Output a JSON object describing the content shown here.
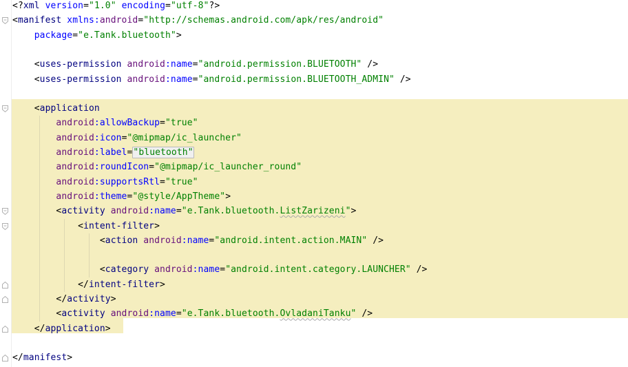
{
  "lines": [
    {
      "indent": "",
      "parts": [
        [
          "p",
          "<"
        ],
        [
          "p",
          "?"
        ],
        [
          "t",
          "xml "
        ],
        [
          "ab",
          "version"
        ],
        [
          "p",
          "="
        ],
        [
          "s",
          "\"1.0\""
        ],
        [
          "p",
          " "
        ],
        [
          "ab",
          "encoding"
        ],
        [
          "p",
          "="
        ],
        [
          "s",
          "\"utf-8\""
        ],
        [
          "p",
          "?>"
        ]
      ]
    },
    {
      "indent": "",
      "parts": [
        [
          "p",
          "<"
        ],
        [
          "t",
          "manifest "
        ],
        [
          "ab",
          "xmlns:"
        ],
        [
          "ans",
          "android"
        ],
        [
          "p",
          "="
        ],
        [
          "s",
          "\"http://schemas.android.com/apk/res/android\""
        ]
      ]
    },
    {
      "indent": "    ",
      "parts": [
        [
          "ab",
          "package"
        ],
        [
          "p",
          "="
        ],
        [
          "s",
          "\"e.Tank.bluetooth\""
        ],
        [
          "p",
          ">"
        ]
      ]
    },
    {
      "indent": "",
      "parts": []
    },
    {
      "indent": "    ",
      "parts": [
        [
          "p",
          "<"
        ],
        [
          "t",
          "uses-permission "
        ],
        [
          "ans",
          "android"
        ],
        [
          "ab",
          ":name"
        ],
        [
          "p",
          "="
        ],
        [
          "s",
          "\"android.permission.BLUETOOTH\""
        ],
        [
          "p",
          " />"
        ]
      ]
    },
    {
      "indent": "    ",
      "parts": [
        [
          "p",
          "<"
        ],
        [
          "t",
          "uses-permission "
        ],
        [
          "ans",
          "android"
        ],
        [
          "ab",
          ":name"
        ],
        [
          "p",
          "="
        ],
        [
          "s",
          "\"android.permission.BLUETOOTH_ADMIN\""
        ],
        [
          "p",
          " />"
        ]
      ]
    },
    {
      "indent": "",
      "parts": []
    },
    {
      "indent": "    ",
      "parts": [
        [
          "p",
          "<"
        ],
        [
          "t",
          "application"
        ]
      ]
    },
    {
      "indent": "        ",
      "parts": [
        [
          "ans",
          "android"
        ],
        [
          "ab",
          ":allowBackup"
        ],
        [
          "p",
          "="
        ],
        [
          "s",
          "\"true\""
        ]
      ]
    },
    {
      "indent": "        ",
      "parts": [
        [
          "ans",
          "android"
        ],
        [
          "ab",
          ":icon"
        ],
        [
          "p",
          "="
        ],
        [
          "s",
          "\"@mipmap/ic_launcher\""
        ]
      ]
    },
    {
      "indent": "        ",
      "parts": [
        [
          "ans",
          "android"
        ],
        [
          "ab",
          ":label"
        ],
        [
          "p",
          "="
        ],
        [
          "sbox",
          "\"bluetooth\""
        ]
      ]
    },
    {
      "indent": "        ",
      "parts": [
        [
          "ans",
          "android"
        ],
        [
          "ab",
          ":roundIcon"
        ],
        [
          "p",
          "="
        ],
        [
          "s",
          "\"@mipmap/ic_launcher_round\""
        ]
      ]
    },
    {
      "indent": "        ",
      "parts": [
        [
          "ans",
          "android"
        ],
        [
          "ab",
          ":supportsRtl"
        ],
        [
          "p",
          "="
        ],
        [
          "s",
          "\"true\""
        ]
      ]
    },
    {
      "indent": "        ",
      "parts": [
        [
          "ans",
          "android"
        ],
        [
          "ab",
          ":theme"
        ],
        [
          "p",
          "="
        ],
        [
          "s",
          "\"@style/AppTheme\""
        ],
        [
          "p",
          ">"
        ]
      ]
    },
    {
      "indent": "        ",
      "parts": [
        [
          "p",
          "<"
        ],
        [
          "t",
          "activity "
        ],
        [
          "ans",
          "android"
        ],
        [
          "ab",
          ":name"
        ],
        [
          "p",
          "="
        ],
        [
          "s",
          "\"e.Tank.bluetooth."
        ],
        [
          "sq",
          "ListZarizeni"
        ],
        [
          "s",
          "\""
        ],
        [
          "p",
          ">"
        ]
      ]
    },
    {
      "indent": "            ",
      "parts": [
        [
          "p",
          "<"
        ],
        [
          "t",
          "intent-filter"
        ],
        [
          "p",
          ">"
        ]
      ]
    },
    {
      "indent": "                ",
      "parts": [
        [
          "p",
          "<"
        ],
        [
          "t",
          "action "
        ],
        [
          "ans",
          "android"
        ],
        [
          "ab",
          ":name"
        ],
        [
          "p",
          "="
        ],
        [
          "s",
          "\"android.intent.action.MAIN\""
        ],
        [
          "p",
          " />"
        ]
      ]
    },
    {
      "indent": "",
      "parts": []
    },
    {
      "indent": "                ",
      "parts": [
        [
          "p",
          "<"
        ],
        [
          "t",
          "category "
        ],
        [
          "ans",
          "android"
        ],
        [
          "ab",
          ":name"
        ],
        [
          "p",
          "="
        ],
        [
          "s",
          "\"android.intent.category.LAUNCHER\""
        ],
        [
          "p",
          " />"
        ]
      ]
    },
    {
      "indent": "            ",
      "parts": [
        [
          "p",
          "</"
        ],
        [
          "t",
          "intent-filter"
        ],
        [
          "p",
          ">"
        ]
      ]
    },
    {
      "indent": "        ",
      "parts": [
        [
          "p",
          "</"
        ],
        [
          "t",
          "activity"
        ],
        [
          "p",
          ">"
        ]
      ]
    },
    {
      "indent": "        ",
      "parts": [
        [
          "p",
          "<"
        ],
        [
          "t",
          "activity "
        ],
        [
          "ans",
          "android"
        ],
        [
          "ab",
          ":name"
        ],
        [
          "p",
          "="
        ],
        [
          "s",
          "\"e.Tank.bluetooth."
        ],
        [
          "sq",
          "OvladaniTanku"
        ],
        [
          "s",
          "\""
        ],
        [
          "p",
          " />"
        ]
      ]
    },
    {
      "indent": "    ",
      "parts": [
        [
          "p",
          "</"
        ],
        [
          "t",
          "application"
        ],
        [
          "p",
          ">"
        ]
      ]
    },
    {
      "indent": "",
      "parts": []
    },
    {
      "indent": "",
      "parts": [
        [
          "p",
          "</"
        ],
        [
          "t",
          "manifest"
        ],
        [
          "p",
          ">"
        ]
      ]
    }
  ],
  "colors": {
    "tag": "#000080",
    "attribute": "#0000ff",
    "namespace": "#660e7a",
    "string": "#008000",
    "highlight": "#f5eebf",
    "fold_marker": "#a8a8a8"
  },
  "fold_markers": [
    {
      "line": 1,
      "kind": "open"
    },
    {
      "line": 7,
      "kind": "open"
    },
    {
      "line": 14,
      "kind": "open"
    },
    {
      "line": 15,
      "kind": "open"
    },
    {
      "line": 19,
      "kind": "close"
    },
    {
      "line": 20,
      "kind": "close"
    },
    {
      "line": 22,
      "kind": "close"
    },
    {
      "line": 24,
      "kind": "close"
    }
  ],
  "icons": {
    "fold_open": "fold-open-icon",
    "fold_close": "fold-close-icon"
  }
}
